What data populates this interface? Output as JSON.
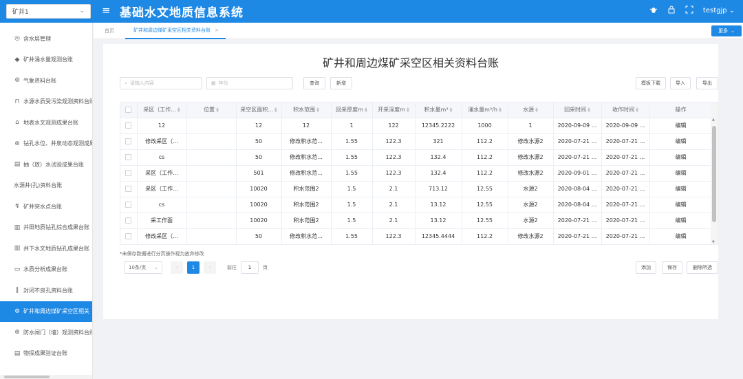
{
  "header": {
    "mine_select": "矿井1",
    "title": "基础水文地质信息系统",
    "username": "testgjp"
  },
  "sidebar": {
    "items": [
      {
        "label": "含水层管理",
        "icon": "layers-icon"
      },
      {
        "label": "矿井涌水量观测台账",
        "icon": "graduation-cap-icon"
      },
      {
        "label": "气象资料台账",
        "icon": "gear-icon"
      },
      {
        "label": "水源水质受污染观测资料台账",
        "icon": "pipe-icon"
      },
      {
        "label": "地表水文观测成果台账",
        "icon": "home-icon"
      },
      {
        "label": "钻孔水位、井泉动态观测成果",
        "icon": "drill-icon"
      },
      {
        "label": "抽（放）水试验成果台账",
        "icon": "document-icon"
      },
      {
        "label": "水源井(孔)资料台账",
        "icon": ""
      },
      {
        "label": "矿井突水点台账",
        "icon": "curve-icon"
      },
      {
        "label": "井田地质钻孔综合成果台账",
        "icon": "building-icon"
      },
      {
        "label": "井下水文地质钻孔成果台账",
        "icon": "building-icon"
      },
      {
        "label": "水质分析成果台账",
        "icon": "monitor-icon"
      },
      {
        "label": "封闭不良孔资料台账",
        "icon": "bars-icon"
      },
      {
        "label": "矿井和周边煤矿采空区相关",
        "icon": "gear-icon",
        "active": true
      },
      {
        "label": "防水闸门（墙）观测资料台账",
        "icon": "gate-icon"
      },
      {
        "label": "物探成果验证台账",
        "icon": "document-icon"
      }
    ]
  },
  "tabs": {
    "home": "首页",
    "active": "矿井和周边煤矿采空区相关资料台账",
    "more": "更多"
  },
  "main": {
    "title": "矿井和周边煤矿采空区相关资料台账",
    "search_placeholder": "请输入内容",
    "year_placeholder": "年份",
    "buttons": {
      "query": "查询",
      "add": "新增",
      "template": "模板下载",
      "import": "导入",
      "export": "导出",
      "append": "添加",
      "save": "保存",
      "delete_selected": "删除所选"
    }
  },
  "table": {
    "columns": [
      "采区（工作...",
      "位置",
      "采空区面积...",
      "积水范围",
      "回采厚度m",
      "开采深度m",
      "积水量m³",
      "涌水量m³/h",
      "水源",
      "回采时间",
      "收作时间",
      "操作"
    ],
    "rows": [
      [
        "12",
        "",
        "12",
        "12",
        "1",
        "122",
        "12345.2222",
        "1000",
        "1",
        "2020-09-09 ...",
        "2020-09-09 ...",
        "编辑"
      ],
      [
        "修改采区（...",
        "",
        "50",
        "修改积水范...",
        "1.55",
        "122.3",
        "321",
        "112.2",
        "修改水源2",
        "2020-07-21 ...",
        "2020-07-21 ...",
        "编辑"
      ],
      [
        "cs",
        "",
        "50",
        "修改积水范...",
        "1.55",
        "122.3",
        "132.4",
        "112.2",
        "修改水源2",
        "2020-07-21 ...",
        "2020-07-21 ...",
        "编辑"
      ],
      [
        "采区（工作...",
        "",
        "501",
        "修改积水范...",
        "1.55",
        "122.3",
        "132.4",
        "112.2",
        "修改水源2",
        "2020-09-01 ...",
        "2020-07-21 ...",
        "编辑"
      ],
      [
        "采区（工作...",
        "",
        "10020",
        "积水范围2",
        "1.5",
        "2.1",
        "713.12",
        "12.55",
        "水源2",
        "2020-08-04 ...",
        "2020-07-21 ...",
        "编辑"
      ],
      [
        "cs",
        "",
        "10020",
        "积水范围2",
        "1.5",
        "2.1",
        "13.12",
        "12.55",
        "水源2",
        "2020-08-04 ...",
        "2020-07-21 ...",
        "编辑"
      ],
      [
        "采工作面",
        "",
        "10020",
        "积水范围2",
        "1.5",
        "2.1",
        "13.12",
        "12.55",
        "水源2",
        "2020-07-21 ...",
        "2020-07-21 ...",
        "编辑"
      ],
      [
        "修改采区（...",
        "",
        "50",
        "修改积水范...",
        "1.55",
        "122.3",
        "12345.4444",
        "112.2",
        "修改水源2",
        "2020-07-21 ...",
        "2020-07-21 ...",
        "编辑"
      ]
    ]
  },
  "footer": {
    "note": "*未保存数据进行分页操作视为放弃修改",
    "page_size": "10条/页",
    "current_page": "1",
    "goto_label": "前往",
    "goto_value": "1",
    "page_unit": "页"
  },
  "colors": {
    "primary": "#1e88e5"
  }
}
